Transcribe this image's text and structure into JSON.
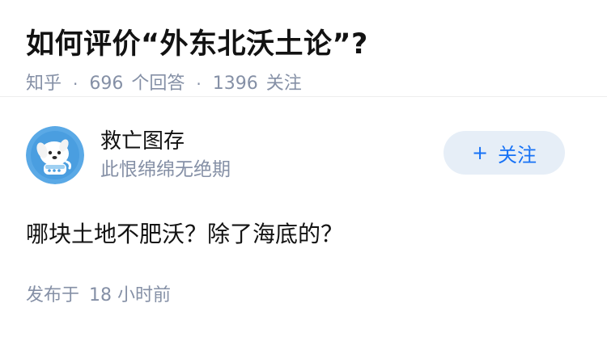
{
  "question": {
    "title": "如何评价“外东北沃土论”?",
    "source": "知乎",
    "separator": "·",
    "answer_count": "696",
    "answer_label": "个回答",
    "follower_count": "1396",
    "follower_label": "关注"
  },
  "answer": {
    "author": {
      "name": "救亡图存",
      "bio": "此恨绵绵无绝期",
      "avatar_icon": "dog-mascot-avatar"
    },
    "follow_button": {
      "icon": "+",
      "label": "关注"
    },
    "content": "哪块土地不肥沃？除了海底的？",
    "published_label": "发布于",
    "published_time": "18 小时前"
  },
  "colors": {
    "title": "#121212",
    "meta": "#8590a6",
    "accent": "#1772f6",
    "button_bg": "#e6eef7",
    "avatar_bg": "#5aa9e6"
  }
}
